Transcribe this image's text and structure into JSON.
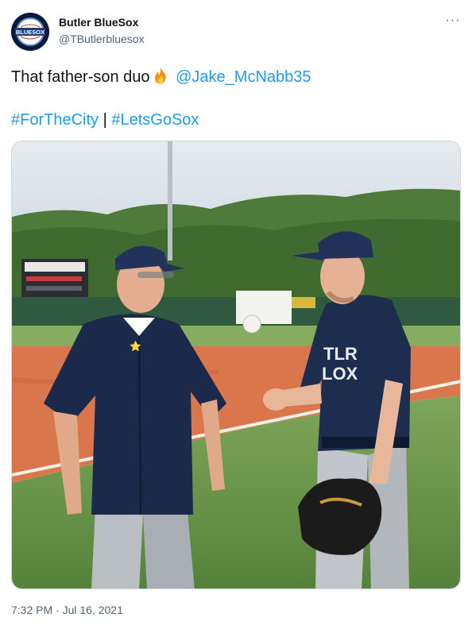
{
  "author": {
    "name": "Butler BlueSox",
    "handle": "@TButlerbluesox",
    "avatar_text": "BLUESOX"
  },
  "menu": {
    "more_label": "···",
    "more_icon": "more-horizontal-icon"
  },
  "tweet": {
    "text": "That father-son duo",
    "emoji": "fire-icon",
    "mention": "@Jake_McNabb35",
    "hashtag_1": "#ForTheCity",
    "separator": "|",
    "hashtag_2": "#LetsGoSox"
  },
  "media": {
    "jersey_text_line_1": "TLR",
    "jersey_text_line_2": "LOX"
  },
  "meta": {
    "timestamp": "7:32 PM · Jul 16, 2021"
  },
  "colors": {
    "link": "#1d9bf0",
    "text": "#0f1419",
    "secondary": "#536471",
    "navy": "#1b2a4a",
    "field": "#5f8a3e",
    "dirt": "#d9764b"
  }
}
